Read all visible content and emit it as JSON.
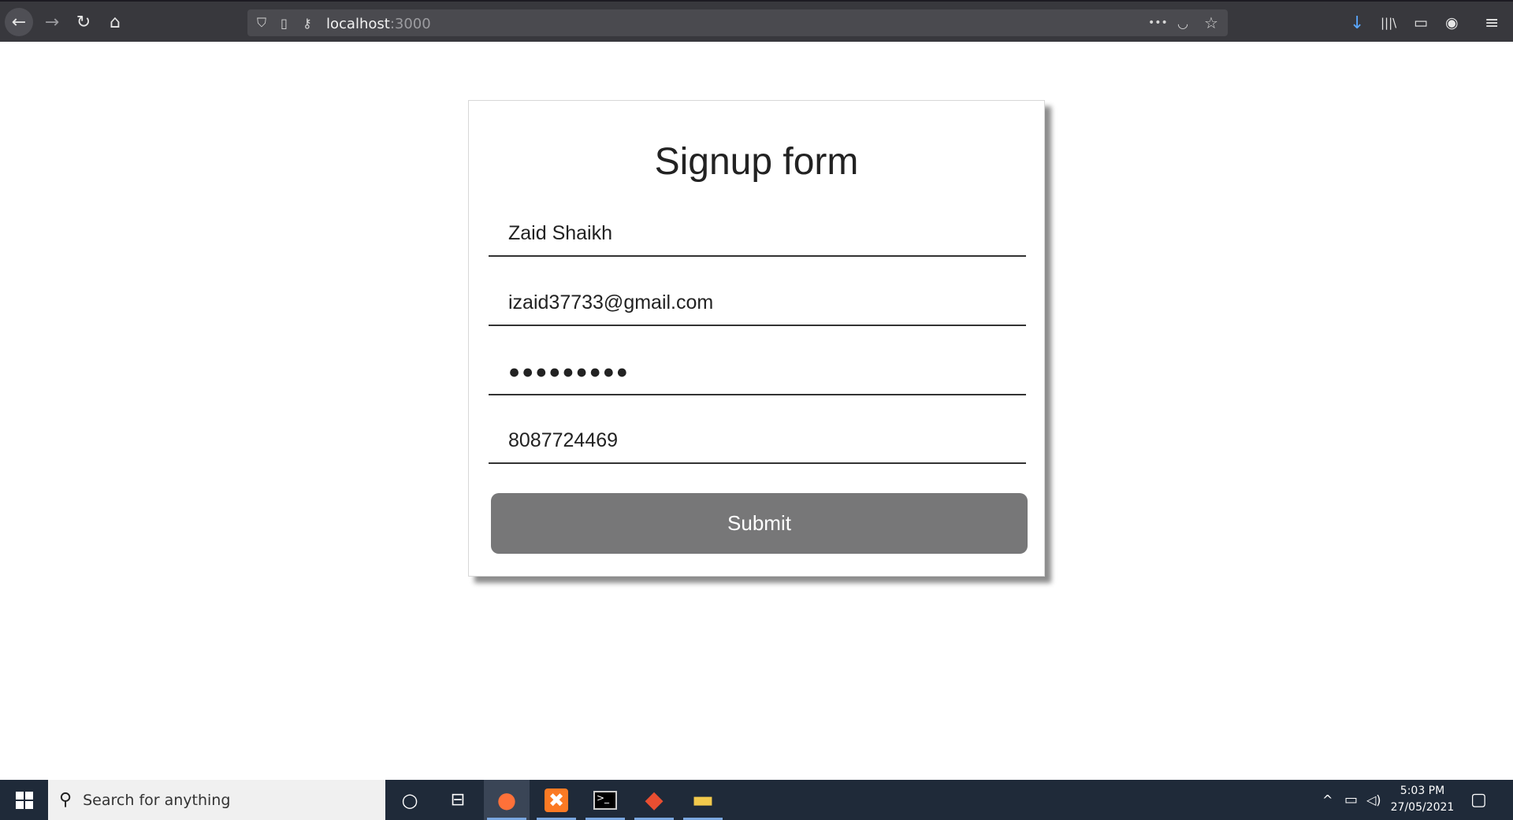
{
  "browser": {
    "url_host": "localhost",
    "url_port": ":3000",
    "back_icon": "←",
    "forward_icon": "→",
    "reload_icon": "↻",
    "home_icon": "⌂",
    "more_icon": "•••",
    "pocket_icon": "◡",
    "bookmark_icon": "☆",
    "download_icon": "↓",
    "library_icon": "|||\\",
    "sidebar_icon": "▭",
    "account_icon": "◉",
    "menu_icon": "≡",
    "shield_icon": "⛉",
    "page_icon": "▯",
    "key_icon": "⚷"
  },
  "form": {
    "title": "Signup form",
    "name_value": "Zaid Shaikh",
    "email_value": "izaid37733@gmail.com",
    "password_value": "●●●●●●●●●",
    "phone_value": "8087724469",
    "submit_label": "Submit"
  },
  "taskbar": {
    "search_placeholder": "Search for anything",
    "search_icon": "⚲",
    "cortana_icon": "○",
    "taskview_icon": "⊟",
    "time": "5:03 PM",
    "date": "27/05/2021",
    "tray_up_icon": "^",
    "battery_icon": "▭",
    "volume_icon": "◁)",
    "notification_icon": "▢",
    "apps": [
      {
        "name": "Firefox",
        "glyph": "●",
        "color": "#ff7139"
      },
      {
        "name": "XAMPP",
        "glyph": "✖",
        "color": "#fb7a24"
      },
      {
        "name": "Terminal",
        "glyph": ">_",
        "color": "#000000"
      },
      {
        "name": "Git",
        "glyph": "◆",
        "color": "#e94e31"
      },
      {
        "name": "File Explorer",
        "glyph": "▬",
        "color": "#f2c94c"
      }
    ]
  }
}
